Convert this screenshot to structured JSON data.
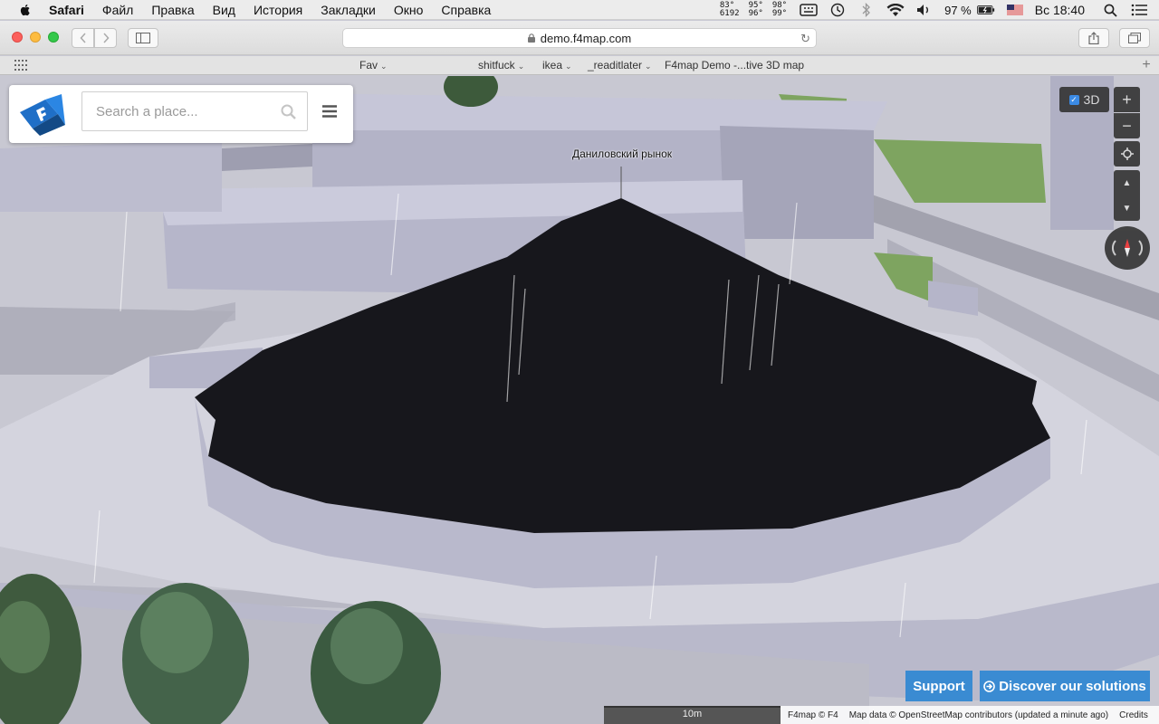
{
  "menubar": {
    "app": "Safari",
    "items": [
      "Файл",
      "Правка",
      "Вид",
      "История",
      "Закладки",
      "Окно",
      "Справка"
    ],
    "temps": [
      [
        "83°",
        "6192"
      ],
      [
        "95°",
        "96°"
      ],
      [
        "98°",
        "99°"
      ]
    ],
    "battery": "97 %",
    "clock": "Вс 18:40"
  },
  "browser": {
    "url": "demo.f4map.com",
    "bookmarks": [
      "Fav",
      "shitfuck",
      "ikea",
      "_readitlater",
      "F4map Demo -...tive 3D map"
    ]
  },
  "map": {
    "search_placeholder": "Search a place...",
    "place_label": "Даниловский рынок",
    "toggle_3d": "3D",
    "zoom_in": "+",
    "zoom_out": "−",
    "support_label": "Support",
    "discover_label": "Discover our solutions",
    "scale_label": "10m",
    "attribution": [
      "F4map © F4",
      "Map data © OpenStreetMap contributors (updated a minute ago)",
      "Credits"
    ],
    "colors": {
      "button_blue": "#3a8bd2",
      "dome": "#17171c",
      "building": "#b3b3c7",
      "grass": "#7ea460"
    }
  }
}
